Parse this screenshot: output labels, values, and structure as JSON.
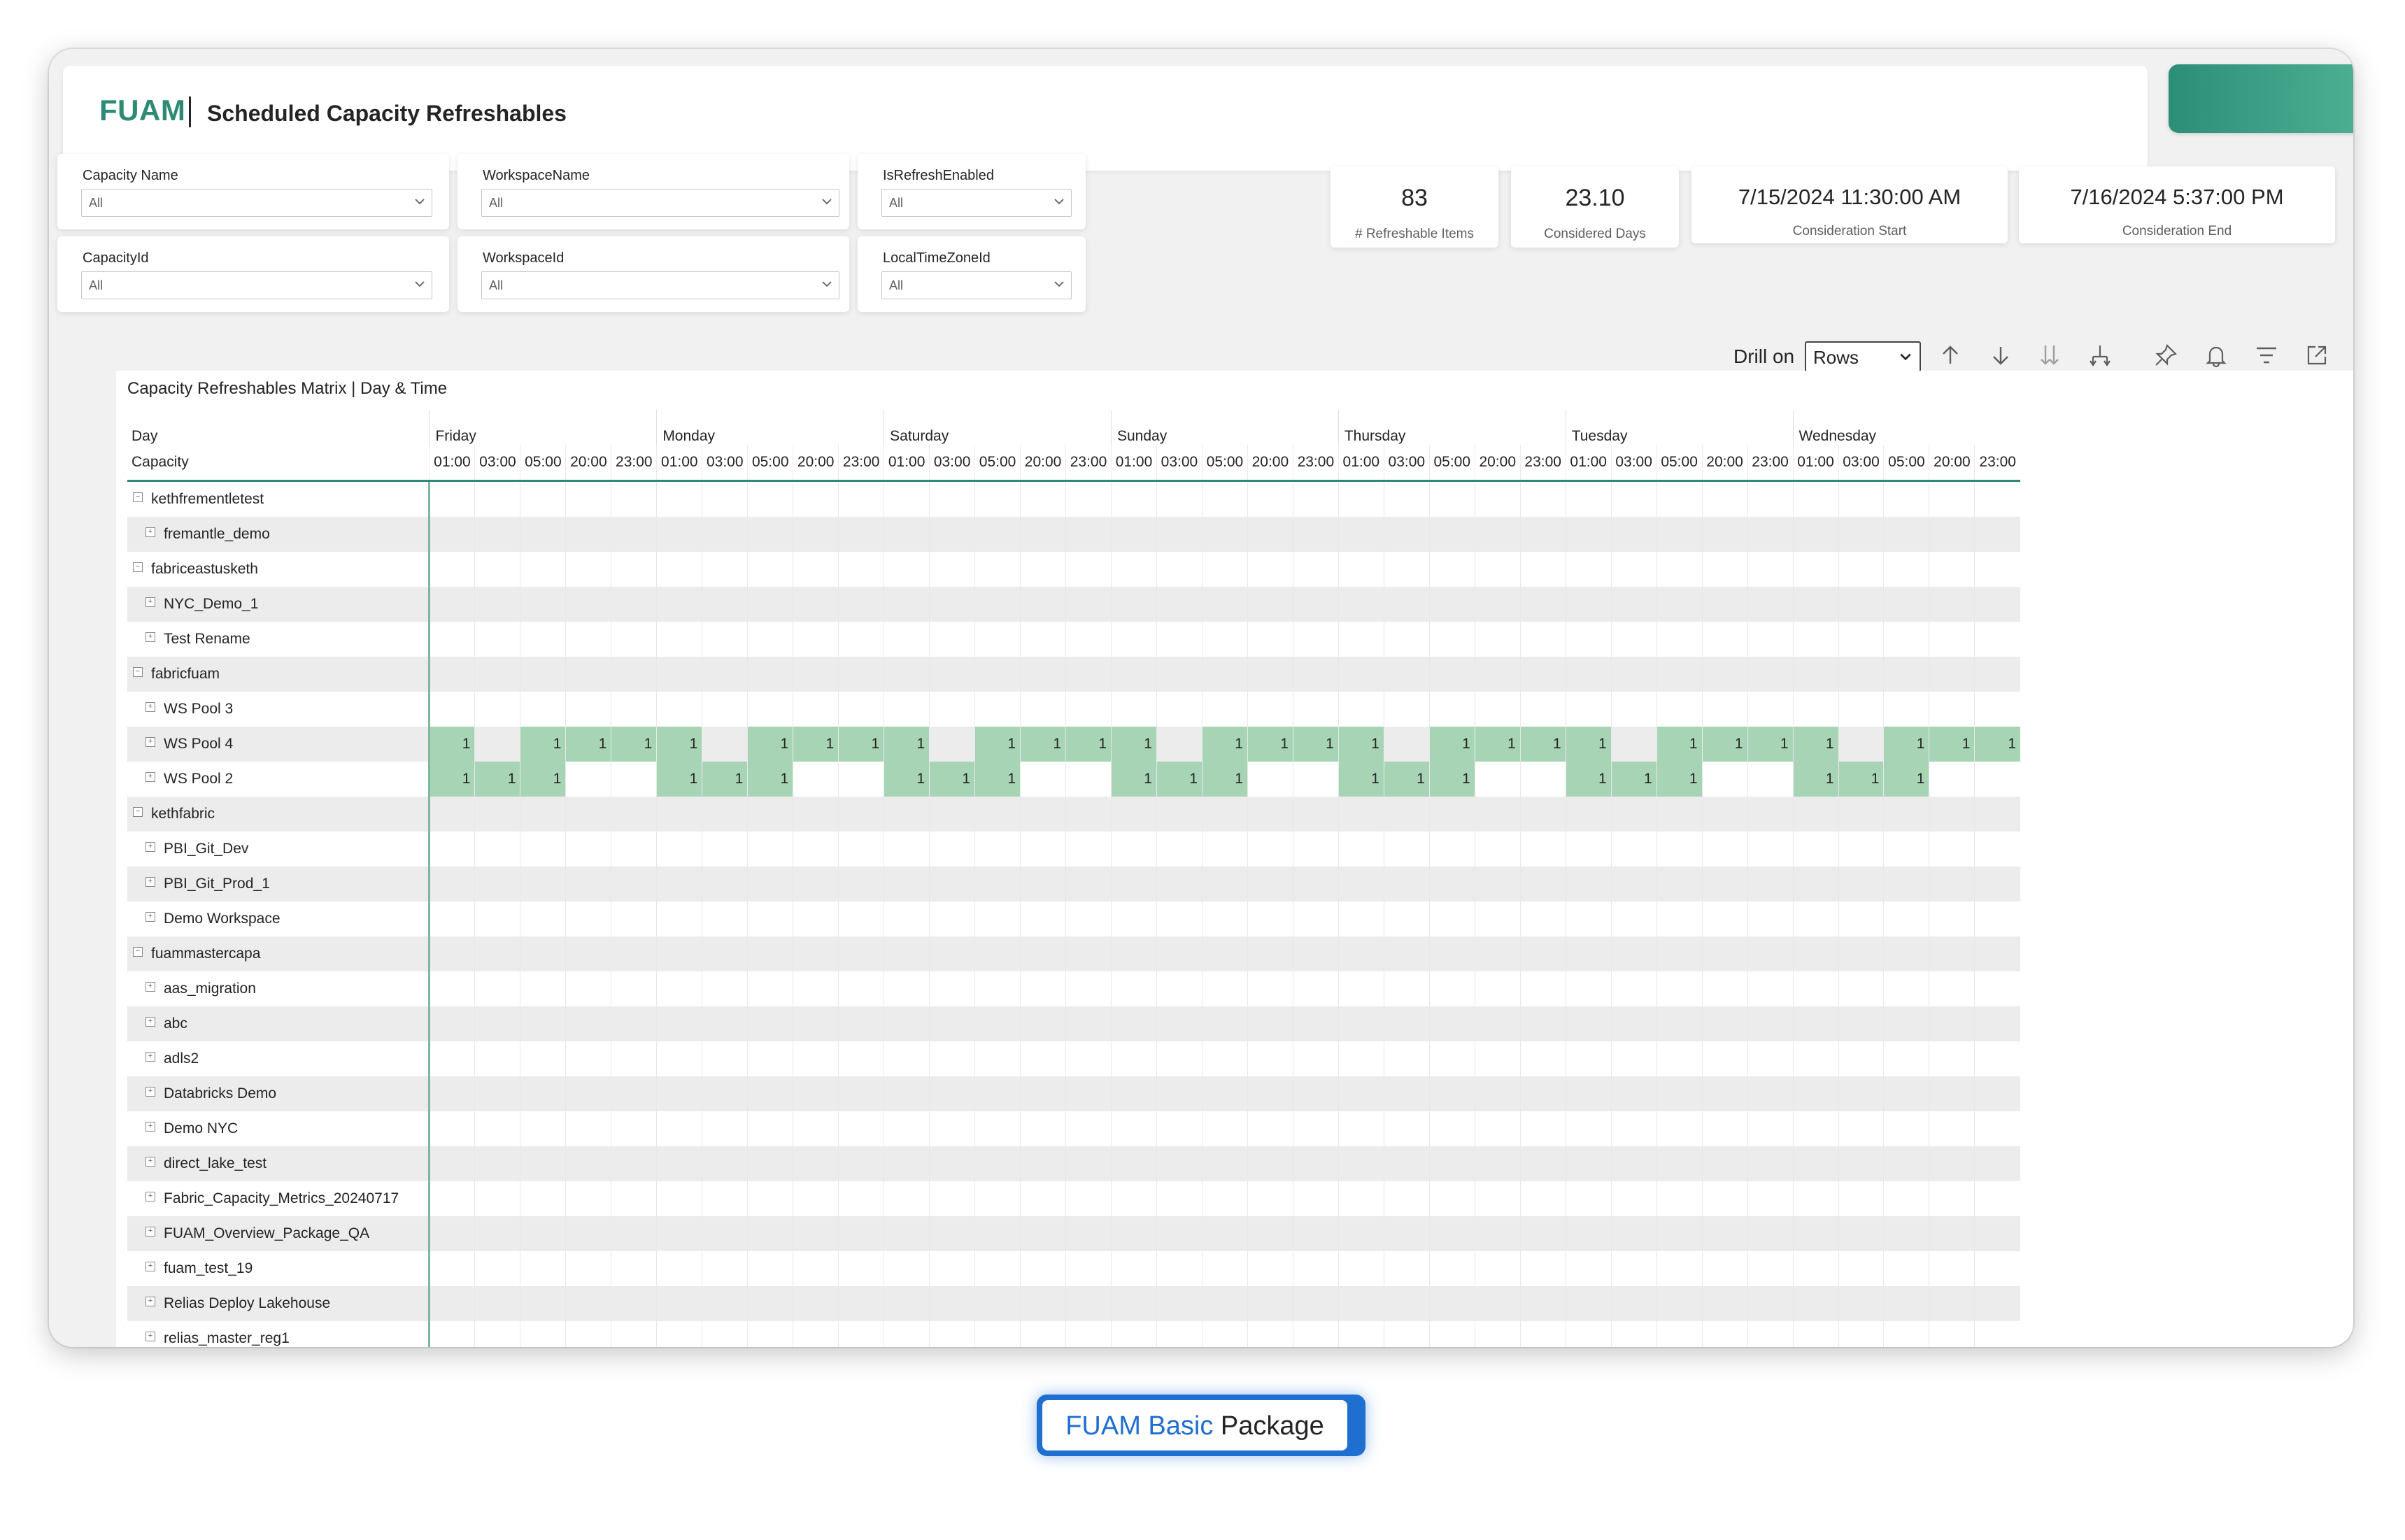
{
  "header": {
    "brand": "FUAM",
    "title": "Scheduled Capacity Refreshables"
  },
  "slicers": [
    {
      "label": "Capacity Name",
      "value": "All"
    },
    {
      "label": "WorkspaceName",
      "value": "All"
    },
    {
      "label": "IsRefreshEnabled",
      "value": "All"
    },
    {
      "label": "CapacityId",
      "value": "All"
    },
    {
      "label": "WorkspaceId",
      "value": "All"
    },
    {
      "label": "LocalTimeZoneId",
      "value": "All"
    }
  ],
  "kpis": [
    {
      "value": "83",
      "label": "# Refreshable Items"
    },
    {
      "value": "23.10",
      "label": "Considered Days"
    },
    {
      "value": "7/15/2024 11:30:00 AM",
      "label": "Consideration Start"
    },
    {
      "value": "7/16/2024 5:37:00 PM",
      "label": "Consideration End"
    }
  ],
  "toolbar": {
    "drill_label": "Drill on",
    "drill_value": "Rows",
    "icons": [
      "drill-up-icon",
      "drill-down-icon",
      "expand-all-icon",
      "expand-hierarchy-icon",
      "pin-icon",
      "alert-bell-icon",
      "filter-icon",
      "focus-mode-icon",
      "more-options-icon"
    ]
  },
  "matrix": {
    "title": "Capacity Refreshables Matrix | Day & Time",
    "row_header_day": "Day",
    "row_header_capacity": "Capacity",
    "days": [
      "Friday",
      "Monday",
      "Saturday",
      "Sunday",
      "Thursday",
      "Tuesday",
      "Wednesday"
    ],
    "hours": [
      "01:00",
      "03:00",
      "05:00",
      "20:00",
      "23:00"
    ],
    "rows": [
      {
        "label": "kethfrementletest",
        "level": 0,
        "values": []
      },
      {
        "label": "fremantle_demo",
        "level": 1,
        "values": []
      },
      {
        "label": "fabriceastusketh",
        "level": 0,
        "values": []
      },
      {
        "label": "NYC_Demo_1",
        "level": 1,
        "values": []
      },
      {
        "label": "Test Rename",
        "level": 1,
        "values": []
      },
      {
        "label": "fabricfuam",
        "level": 0,
        "values": []
      },
      {
        "label": "WS Pool 3",
        "level": 1,
        "values": []
      },
      {
        "label": "WS Pool 4",
        "level": 1,
        "values": [
          "1",
          "",
          "1",
          "1",
          "1",
          "1",
          "",
          "1",
          "1",
          "1",
          "1",
          "",
          "1",
          "1",
          "1",
          "1",
          "",
          "1",
          "1",
          "1",
          "1",
          "",
          "1",
          "1",
          "1",
          "1",
          "",
          "1",
          "1",
          "1",
          "1",
          "",
          "1",
          "1",
          "1"
        ]
      },
      {
        "label": "WS Pool 2",
        "level": 1,
        "values": [
          "1",
          "1",
          "1",
          "",
          "",
          "1",
          "1",
          "1",
          "",
          "",
          "1",
          "1",
          "1",
          "",
          "",
          "1",
          "1",
          "1",
          "",
          "",
          "1",
          "1",
          "1",
          "",
          "",
          "1",
          "1",
          "1",
          "",
          "",
          "1",
          "1",
          "1",
          "",
          ""
        ]
      },
      {
        "label": "kethfabric",
        "level": 0,
        "values": []
      },
      {
        "label": "PBI_Git_Dev",
        "level": 1,
        "values": []
      },
      {
        "label": "PBI_Git_Prod_1",
        "level": 1,
        "values": []
      },
      {
        "label": "Demo Workspace",
        "level": 1,
        "values": []
      },
      {
        "label": "fuammastercapa",
        "level": 0,
        "values": []
      },
      {
        "label": "aas_migration",
        "level": 1,
        "values": []
      },
      {
        "label": "abc",
        "level": 1,
        "values": []
      },
      {
        "label": "adls2",
        "level": 1,
        "values": []
      },
      {
        "label": "Databricks Demo",
        "level": 1,
        "values": []
      },
      {
        "label": "Demo NYC",
        "level": 1,
        "values": []
      },
      {
        "label": "direct_lake_test",
        "level": 1,
        "values": []
      },
      {
        "label": "Fabric_Capacity_Metrics_20240717",
        "level": 1,
        "values": []
      },
      {
        "label": "FUAM_Overview_Package_QA",
        "level": 1,
        "values": []
      },
      {
        "label": "fuam_test_19",
        "level": 1,
        "values": []
      },
      {
        "label": "Relias Deploy Lakehouse",
        "level": 1,
        "values": []
      },
      {
        "label": "relias_master_reg1",
        "level": 1,
        "values": []
      }
    ]
  },
  "package_badge": {
    "part1": "FUAM Basic",
    "part2": "Package"
  },
  "colors": {
    "brand": "#2e8a75",
    "cell_fill": "#a8d4b6",
    "badge_blue": "#1f6fd0"
  }
}
